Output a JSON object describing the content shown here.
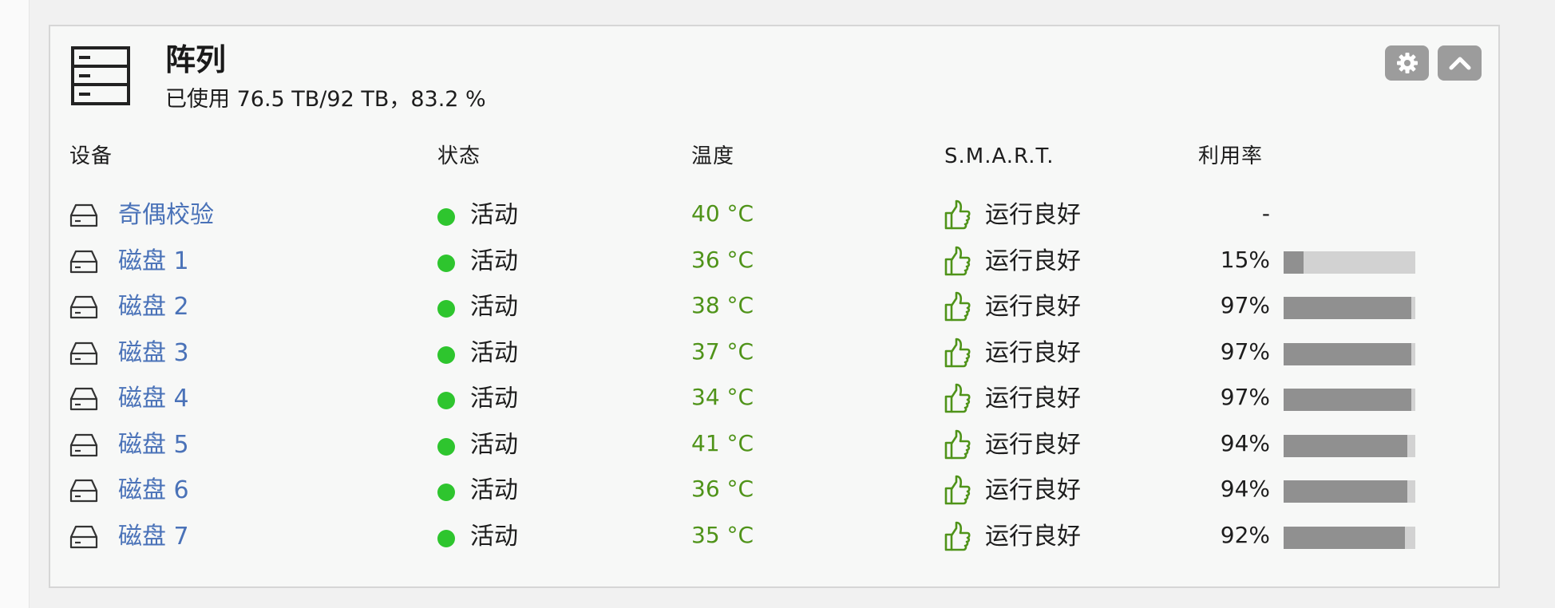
{
  "panel": {
    "title": "阵列",
    "usage": "已使用 76.5 TB/92 TB，83.2 %"
  },
  "buttons": {
    "settings_icon": "gear-icon",
    "collapse_icon": "chevron-up-icon"
  },
  "columns": {
    "device": "设备",
    "status": "状态",
    "temperature": "温度",
    "smart": "S.M.A.R.T.",
    "utilization": "利用率"
  },
  "rows": [
    {
      "device": "奇偶校验",
      "status": "活动",
      "temp": "40 °C",
      "smart": "运行良好",
      "util_label": "-",
      "util": null
    },
    {
      "device": "磁盘 1",
      "status": "活动",
      "temp": "36 °C",
      "smart": "运行良好",
      "util_label": "15%",
      "util": 0.15
    },
    {
      "device": "磁盘 2",
      "status": "活动",
      "temp": "38 °C",
      "smart": "运行良好",
      "util_label": "97%",
      "util": 0.97
    },
    {
      "device": "磁盘 3",
      "status": "活动",
      "temp": "37 °C",
      "smart": "运行良好",
      "util_label": "97%",
      "util": 0.97
    },
    {
      "device": "磁盘 4",
      "status": "活动",
      "temp": "34 °C",
      "smart": "运行良好",
      "util_label": "97%",
      "util": 0.97
    },
    {
      "device": "磁盘 5",
      "status": "活动",
      "temp": "41 °C",
      "smart": "运行良好",
      "util_label": "94%",
      "util": 0.94
    },
    {
      "device": "磁盘 6",
      "status": "活动",
      "temp": "36 °C",
      "smart": "运行良好",
      "util_label": "94%",
      "util": 0.94
    },
    {
      "device": "磁盘 7",
      "status": "活动",
      "temp": "35 °C",
      "smart": "运行良好",
      "util_label": "92%",
      "util": 0.92
    }
  ],
  "colors": {
    "status_active": "#2ec52e",
    "temp": "#4f9319",
    "smart_good": "#4f9319",
    "link": "#4a72b8",
    "bar_fill": "#909090",
    "bar_track": "#d2d2d2",
    "button_bg": "#9c9c9c"
  }
}
